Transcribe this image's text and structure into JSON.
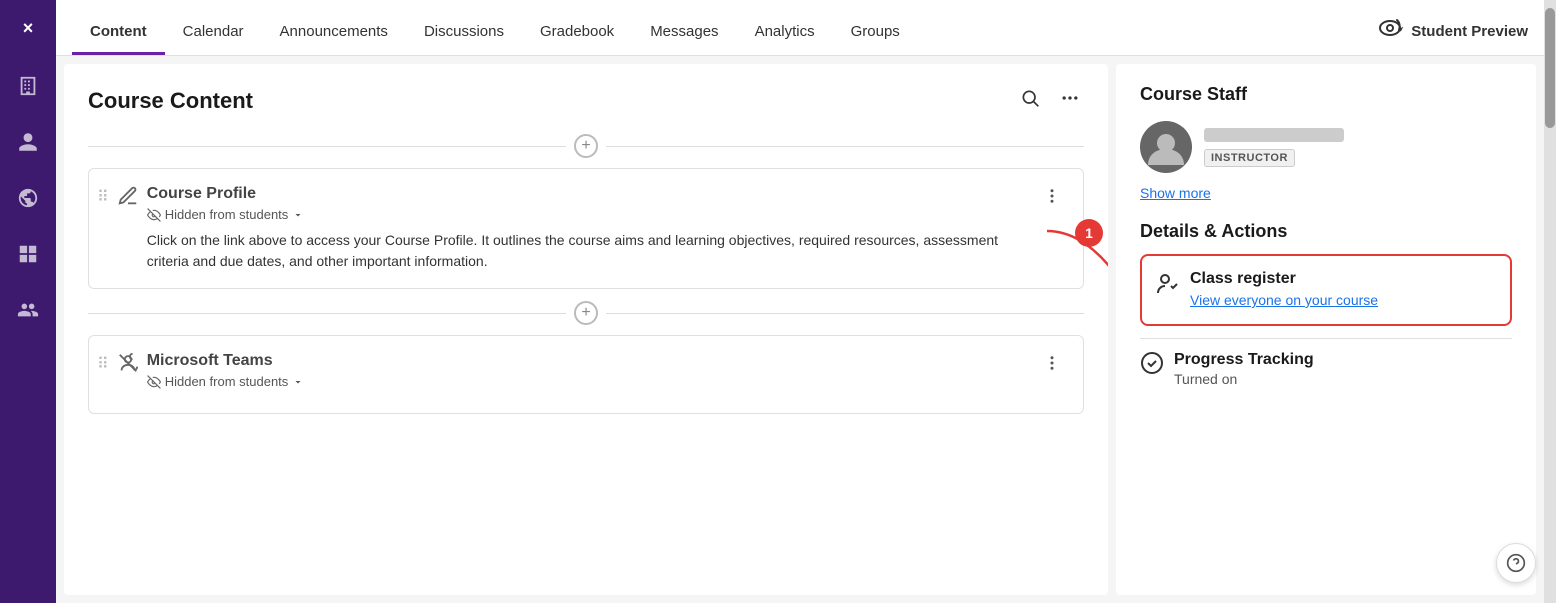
{
  "nav": {
    "tabs": [
      {
        "id": "content",
        "label": "Content",
        "active": true
      },
      {
        "id": "calendar",
        "label": "Calendar",
        "active": false
      },
      {
        "id": "announcements",
        "label": "Announcements",
        "active": false
      },
      {
        "id": "discussions",
        "label": "Discussions",
        "active": false
      },
      {
        "id": "gradebook",
        "label": "Gradebook",
        "active": false
      },
      {
        "id": "messages",
        "label": "Messages",
        "active": false
      },
      {
        "id": "analytics",
        "label": "Analytics",
        "active": false
      },
      {
        "id": "groups",
        "label": "Groups",
        "active": false
      }
    ],
    "studentPreview": "Student Preview"
  },
  "leftPanel": {
    "title": "Course Content",
    "courseProfile": {
      "title": "Course Profile",
      "visibility": "Hidden from students",
      "description": "Click on the link above to access your Course Profile. It outlines the course aims and learning objectives, required resources, assessment criteria and due dates, and other important information.",
      "badge": "1"
    },
    "microsoftTeams": {
      "title": "Microsoft Teams",
      "visibility": "Hidden from students"
    }
  },
  "rightPanel": {
    "courseStaff": {
      "title": "Course Staff",
      "instructorBadge": "INSTRUCTOR",
      "showMore": "Show more"
    },
    "detailsActions": {
      "title": "Details & Actions",
      "classRegister": {
        "title": "Class register",
        "link": "View everyone on your course"
      },
      "progressTracking": {
        "title": "Progress Tracking",
        "status": "Turned on"
      }
    }
  },
  "sidebar": {
    "closeLabel": "×",
    "icons": [
      "building",
      "person",
      "globe",
      "layout"
    ]
  }
}
